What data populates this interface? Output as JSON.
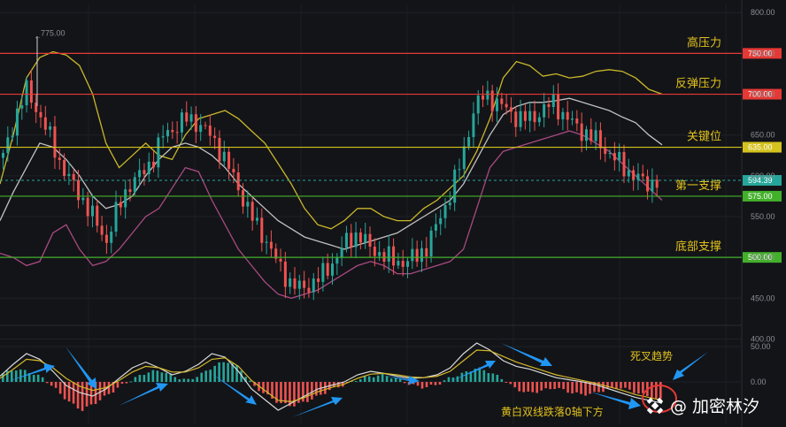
{
  "chart_data": {
    "type": "line",
    "price_axis": {
      "range": [
        420,
        810
      ],
      "ticks": [
        800,
        750,
        700,
        650,
        600,
        550,
        500,
        450,
        400
      ],
      "tick_labels": [
        "800.00",
        "750.00",
        "700.00",
        "650.00",
        "600.00",
        "550.00",
        "500.00",
        "450.00",
        "400.00"
      ]
    },
    "levels": [
      {
        "label": "高压力",
        "value": 750.0,
        "badge": "750.00",
        "color": "#e53935"
      },
      {
        "label": "反弹压力",
        "value": 700.0,
        "badge": "700.00",
        "color": "#e53935"
      },
      {
        "label": "关键位",
        "value": 635.0,
        "badge": "635.00",
        "color": "#d4c21e"
      },
      {
        "label": "第一支撑",
        "value": 575.0,
        "badge": "575.00",
        "color": "#43b02a"
      },
      {
        "label": "底部支撑",
        "value": 500.0,
        "badge": "500.00",
        "color": "#43b02a"
      }
    ],
    "current_price": {
      "value": 594.39,
      "badge": "594.39",
      "color": "#26a69a"
    },
    "high_marker": {
      "text": "775.00",
      "value": 775
    },
    "price_series": [
      {
        "name": "upper",
        "color": "#c9b72a",
        "values": [
          590,
          650,
          720,
          745,
          752,
          748,
          735,
          700,
          640,
          610,
          625,
          640,
          625,
          620,
          650,
          670,
          675,
          680,
          670,
          655,
          640,
          615,
          590,
          560,
          540,
          535,
          545,
          560,
          560,
          550,
          545,
          545,
          560,
          570,
          585,
          600,
          630,
          670,
          720,
          740,
          735,
          722,
          725,
          720,
          722,
          728,
          730,
          728,
          720,
          706,
          700
        ]
      },
      {
        "name": "middle",
        "color": "#c0c0c0",
        "values": [
          545,
          580,
          610,
          640,
          635,
          620,
          600,
          575,
          560,
          565,
          575,
          600,
          620,
          635,
          640,
          635,
          625,
          610,
          590,
          575,
          560,
          545,
          535,
          525,
          520,
          515,
          510,
          515,
          520,
          525,
          530,
          540,
          550,
          560,
          570,
          590,
          620,
          650,
          675,
          685,
          690,
          690,
          692,
          695,
          690,
          685,
          680,
          672,
          665,
          650,
          638
        ]
      },
      {
        "name": "lower",
        "color": "#a84a82",
        "values": [
          505,
          500,
          490,
          495,
          530,
          540,
          510,
          490,
          495,
          510,
          530,
          550,
          560,
          585,
          610,
          605,
          570,
          540,
          510,
          490,
          470,
          455,
          450,
          455,
          460,
          470,
          480,
          490,
          495,
          490,
          480,
          480,
          485,
          490,
          495,
          510,
          560,
          610,
          630,
          635,
          640,
          645,
          650,
          655,
          650,
          640,
          630,
          615,
          600,
          585,
          570
        ]
      }
    ],
    "candles": [
      622,
      670,
      705,
      680,
      650,
      615,
      590,
      570,
      545,
      520,
      560,
      590,
      600,
      620,
      650,
      660,
      670,
      665,
      650,
      630,
      600,
      570,
      540,
      520,
      490,
      470,
      460,
      470,
      480,
      500,
      520,
      530,
      510,
      505,
      495,
      495,
      500,
      515,
      545,
      580,
      620,
      680,
      700,
      690,
      680,
      670,
      670,
      680,
      690,
      672,
      660,
      650,
      640,
      625,
      612,
      600,
      590,
      594
    ],
    "macd_axis": {
      "ticks": [
        50,
        0
      ],
      "tick_labels": [
        "50.00",
        "0.00"
      ],
      "range": [
        -60,
        75
      ]
    },
    "macd_histogram": [
      12,
      18,
      14,
      6,
      -10,
      -28,
      -40,
      -30,
      -18,
      -5,
      5,
      14,
      16,
      8,
      2,
      10,
      22,
      30,
      20,
      -5,
      -18,
      -30,
      -34,
      -28,
      -20,
      -10,
      -4,
      4,
      8,
      10,
      4,
      -4,
      -8,
      -4,
      6,
      12,
      20,
      14,
      4,
      -10,
      -16,
      -12,
      -8,
      -14,
      -18,
      -16,
      -10,
      -8,
      -14,
      -20,
      -26
    ],
    "macd_lines": [
      {
        "name": "white",
        "color": "#d9d9d9",
        "values": [
          8,
          25,
          40,
          32,
          15,
          -5,
          -15,
          -20,
          -10,
          5,
          20,
          28,
          20,
          10,
          15,
          25,
          40,
          35,
          15,
          -10,
          -25,
          -40,
          -30,
          -20,
          -10,
          -5,
          0,
          10,
          15,
          12,
          8,
          5,
          6,
          10,
          20,
          40,
          55,
          45,
          30,
          22,
          18,
          12,
          6,
          3,
          0,
          -4,
          -10,
          -16,
          -22,
          -26,
          -30
        ]
      },
      {
        "name": "yellow",
        "color": "#d4b82a",
        "values": [
          5,
          18,
          32,
          30,
          20,
          5,
          -6,
          -12,
          -8,
          2,
          14,
          22,
          20,
          14,
          14,
          20,
          32,
          34,
          22,
          2,
          -12,
          -26,
          -28,
          -22,
          -14,
          -8,
          -3,
          5,
          11,
          12,
          10,
          7,
          6,
          8,
          15,
          30,
          45,
          44,
          36,
          28,
          22,
          16,
          10,
          6,
          2,
          -2,
          -7,
          -12,
          -18,
          -22,
          -26
        ]
      }
    ],
    "annotations": [
      {
        "text": "死叉趋势",
        "color": "#e2c21c"
      },
      {
        "text": "黄白双线跌落0轴下方",
        "color": "#e2c21c"
      }
    ]
  },
  "watermark": {
    "text": "@ 加密林汐"
  }
}
